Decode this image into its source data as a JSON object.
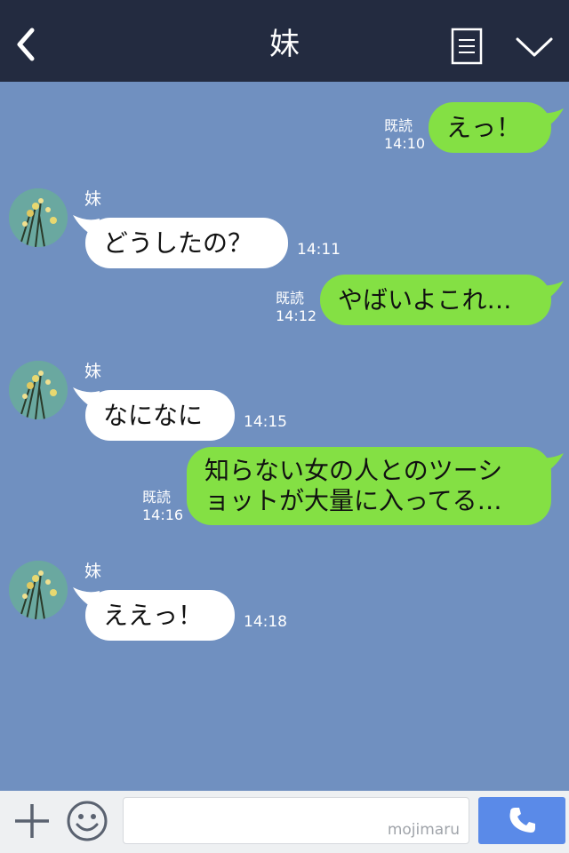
{
  "header": {
    "title": "妹"
  },
  "messages": [
    {
      "side": "out",
      "text": "えっ！",
      "read": "既読",
      "time": "14:10"
    },
    {
      "side": "in",
      "sender": "妹",
      "text": "どうしたの？",
      "time": "14:11"
    },
    {
      "side": "out",
      "text": "やばいよこれ…",
      "read": "既読",
      "time": "14:12"
    },
    {
      "side": "in",
      "sender": "妹",
      "text": "なになに",
      "time": "14:15"
    },
    {
      "side": "out",
      "lines": [
        "知らない女の人とのツーシ",
        "ョットが大量に入ってる…"
      ],
      "read": "既読",
      "time": "14:16"
    },
    {
      "side": "in",
      "sender": "妹",
      "text": "ええっ！",
      "time": "14:18"
    }
  ],
  "input": {
    "watermark": "mojimaru"
  },
  "colors": {
    "header_bg": "#232b40",
    "chat_bg": "#7090c0",
    "outgoing_bubble": "#84e044",
    "incoming_bubble": "#ffffff",
    "call_button": "#5a8ae8"
  },
  "icons": {
    "back": "chevron-left-icon",
    "menu": "menu-icon",
    "collapse": "chevron-down-icon",
    "add": "plus-icon",
    "emoji": "smiley-icon",
    "call": "phone-icon"
  }
}
